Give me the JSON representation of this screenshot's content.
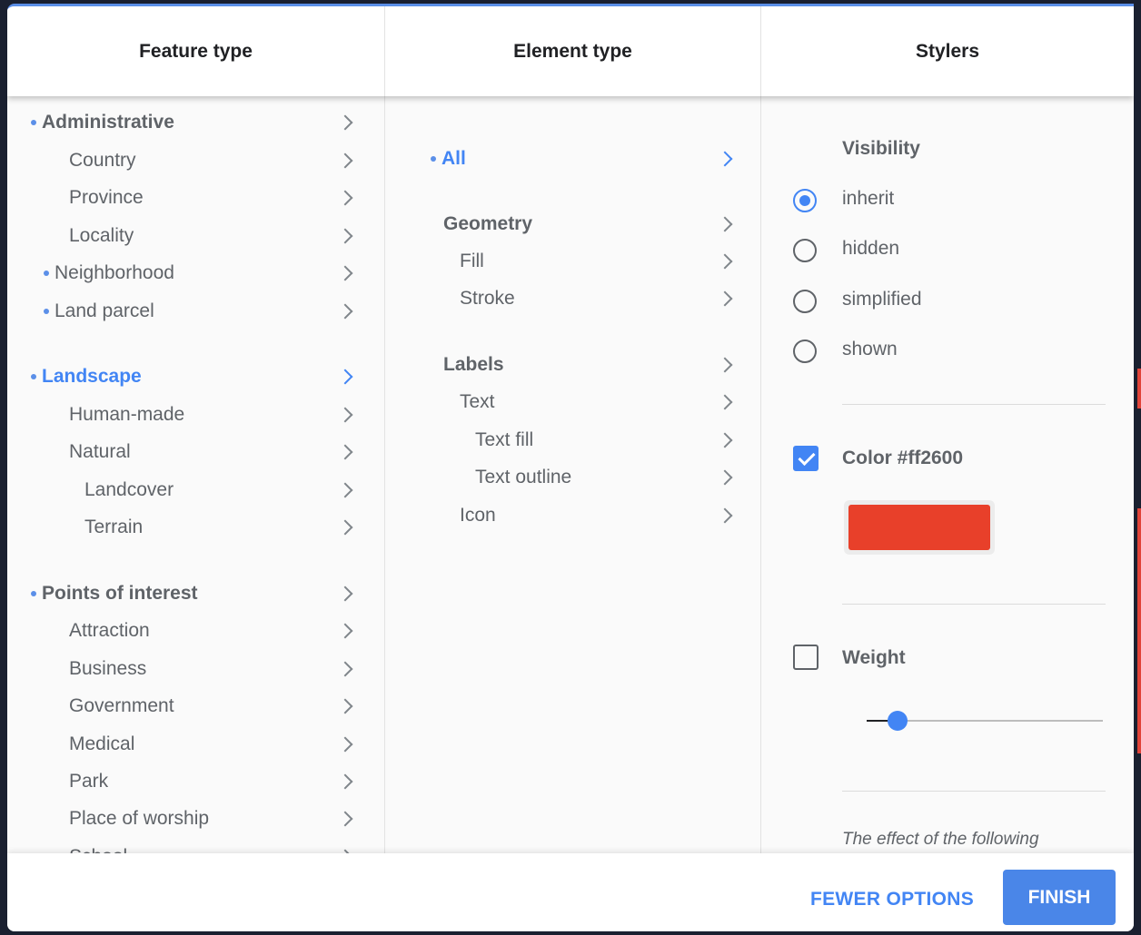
{
  "header": {
    "feature_type": "Feature type",
    "element_type": "Element type",
    "stylers": "Stylers"
  },
  "feature_types": [
    {
      "label": "Administrative",
      "dot": true,
      "style": "bold"
    },
    {
      "label": "Country"
    },
    {
      "label": "Province"
    },
    {
      "label": "Locality"
    },
    {
      "label": "Neighborhood",
      "dot": true
    },
    {
      "label": "Land parcel",
      "dot": true
    },
    {
      "label": "Landscape",
      "dot": true,
      "style": "blue",
      "selected": true
    },
    {
      "label": "Human-made"
    },
    {
      "label": "Natural"
    },
    {
      "label": "Landcover"
    },
    {
      "label": "Terrain"
    },
    {
      "label": "Points of interest",
      "dot": true,
      "style": "bold"
    },
    {
      "label": "Attraction"
    },
    {
      "label": "Business"
    },
    {
      "label": "Government"
    },
    {
      "label": "Medical"
    },
    {
      "label": "Park"
    },
    {
      "label": "Place of worship"
    },
    {
      "label": "School"
    }
  ],
  "element_types": [
    {
      "label": "All",
      "dot": true,
      "style": "blue",
      "selected": true
    },
    {
      "label": "Geometry",
      "style": "bold"
    },
    {
      "label": "Fill"
    },
    {
      "label": "Stroke"
    },
    {
      "label": "Labels",
      "style": "bold"
    },
    {
      "label": "Text"
    },
    {
      "label": "Text fill"
    },
    {
      "label": "Text outline"
    },
    {
      "label": "Icon"
    }
  ],
  "stylers": {
    "visibility_title": "Visibility",
    "visibility_options": [
      "inherit",
      "hidden",
      "simplified",
      "shown"
    ],
    "visibility_selected": "inherit",
    "color_label": "Color #ff2600",
    "color_checked": true,
    "color_value": "#e8402a",
    "weight_label": "Weight",
    "weight_checked": false,
    "weight_level": 0.13,
    "note": "The effect of the following"
  },
  "footer": {
    "fewer_options": "FEWER OPTIONS",
    "finish": "FINISH"
  },
  "colors": {
    "accent": "#4285f4",
    "text": "#5f6368"
  }
}
